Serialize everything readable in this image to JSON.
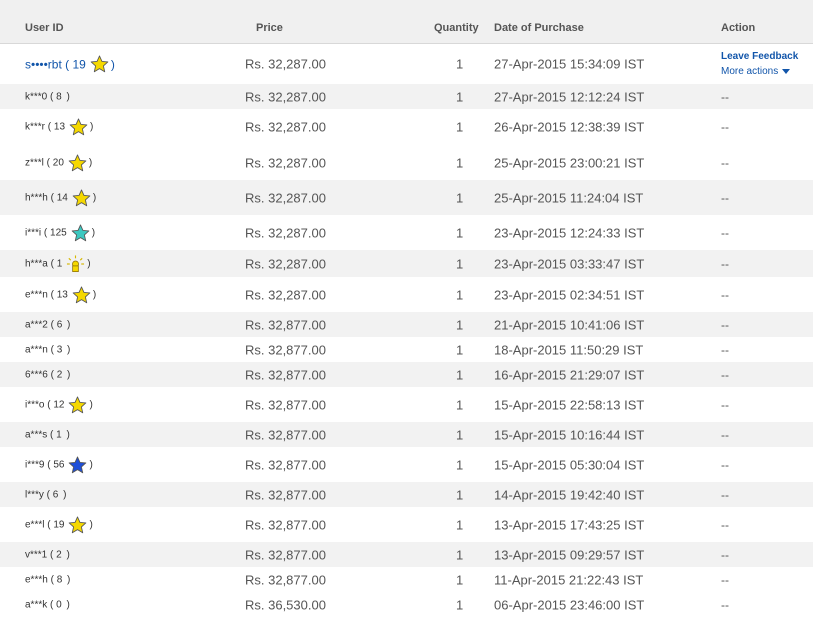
{
  "headers": {
    "user_id": "User ID",
    "price": "Price",
    "quantity": "Quantity",
    "date": "Date of Purchase",
    "action": "Action"
  },
  "rows": [
    {
      "user": "s••••rbt",
      "score": "19",
      "star": "yellow-star",
      "price": "Rs. 32,287.00",
      "qty": "1",
      "date": "27-Apr-2015 15:34:09 IST",
      "leave_feedback": "Leave Feedback",
      "more_actions": "More actions",
      "action": ""
    },
    {
      "user": "k***0",
      "score": "8",
      "star": "",
      "price": "Rs. 32,287.00",
      "qty": "1",
      "date": "27-Apr-2015 12:12:24 IST",
      "action": "--"
    },
    {
      "user": "k***r",
      "score": "13",
      "star": "yellow-star",
      "price": "Rs. 32,287.00",
      "qty": "1",
      "date": "26-Apr-2015 12:38:39 IST",
      "action": "--"
    },
    {
      "user": "z***l",
      "score": "20",
      "star": "yellow-star",
      "price": "Rs. 32,287.00",
      "qty": "1",
      "date": "25-Apr-2015 23:00:21 IST",
      "action": "--"
    },
    {
      "user": "h***h",
      "score": "14",
      "star": "yellow-star",
      "price": "Rs. 32,287.00",
      "qty": "1",
      "date": "25-Apr-2015 11:24:04 IST",
      "action": "--"
    },
    {
      "user": "i***i",
      "score": "125",
      "star": "turquoise-star",
      "price": "Rs. 32,287.00",
      "qty": "1",
      "date": "23-Apr-2015 12:24:33 IST",
      "action": "--"
    },
    {
      "user": "h***a",
      "score": "1",
      "star": "new-member-icon",
      "price": "Rs. 32,287.00",
      "qty": "1",
      "date": "23-Apr-2015 03:33:47 IST",
      "action": "--"
    },
    {
      "user": "e***n",
      "score": "13",
      "star": "yellow-star",
      "price": "Rs. 32,287.00",
      "qty": "1",
      "date": "23-Apr-2015 02:34:51 IST",
      "action": "--"
    },
    {
      "user": "a***2",
      "score": "6",
      "star": "",
      "price": "Rs. 32,877.00",
      "qty": "1",
      "date": "21-Apr-2015 10:41:06 IST",
      "action": "--"
    },
    {
      "user": "a***n",
      "score": "3",
      "star": "",
      "price": "Rs. 32,877.00",
      "qty": "1",
      "date": "18-Apr-2015 11:50:29 IST",
      "action": "--"
    },
    {
      "user": "6***6",
      "score": "2",
      "star": "",
      "price": "Rs. 32,877.00",
      "qty": "1",
      "date": "16-Apr-2015 21:29:07 IST",
      "action": "--"
    },
    {
      "user": "i***o",
      "score": "12",
      "star": "yellow-star",
      "price": "Rs. 32,877.00",
      "qty": "1",
      "date": "15-Apr-2015 22:58:13 IST",
      "action": "--"
    },
    {
      "user": "a***s",
      "score": "1",
      "star": "",
      "price": "Rs. 32,877.00",
      "qty": "1",
      "date": "15-Apr-2015 10:16:44 IST",
      "action": "--"
    },
    {
      "user": "i***9",
      "score": "56",
      "star": "blue-star",
      "price": "Rs. 32,877.00",
      "qty": "1",
      "date": "15-Apr-2015 05:30:04 IST",
      "action": "--"
    },
    {
      "user": "l***y",
      "score": "6",
      "star": "",
      "price": "Rs. 32,877.00",
      "qty": "1",
      "date": "14-Apr-2015 19:42:40 IST",
      "action": "--"
    },
    {
      "user": "e***l",
      "score": "19",
      "star": "yellow-star",
      "price": "Rs. 32,877.00",
      "qty": "1",
      "date": "13-Apr-2015 17:43:25 IST",
      "action": "--"
    },
    {
      "user": "v***1",
      "score": "2",
      "star": "",
      "price": "Rs. 32,877.00",
      "qty": "1",
      "date": "13-Apr-2015 09:29:57 IST",
      "action": "--"
    },
    {
      "user": "e***h",
      "score": "8",
      "star": "",
      "price": "Rs. 32,877.00",
      "qty": "1",
      "date": "11-Apr-2015 21:22:43 IST",
      "action": "--"
    },
    {
      "user": "a***k",
      "score": "0",
      "star": "",
      "price": "Rs. 36,530.00",
      "qty": "1",
      "date": "06-Apr-2015 23:46:00 IST",
      "action": "--"
    }
  ],
  "colors": {
    "link": "#1155aa",
    "yellow_star": "#f5d800",
    "turquoise_star": "#3cc8c0",
    "blue_star": "#1f4fd8",
    "redaction": "#e0101a"
  }
}
